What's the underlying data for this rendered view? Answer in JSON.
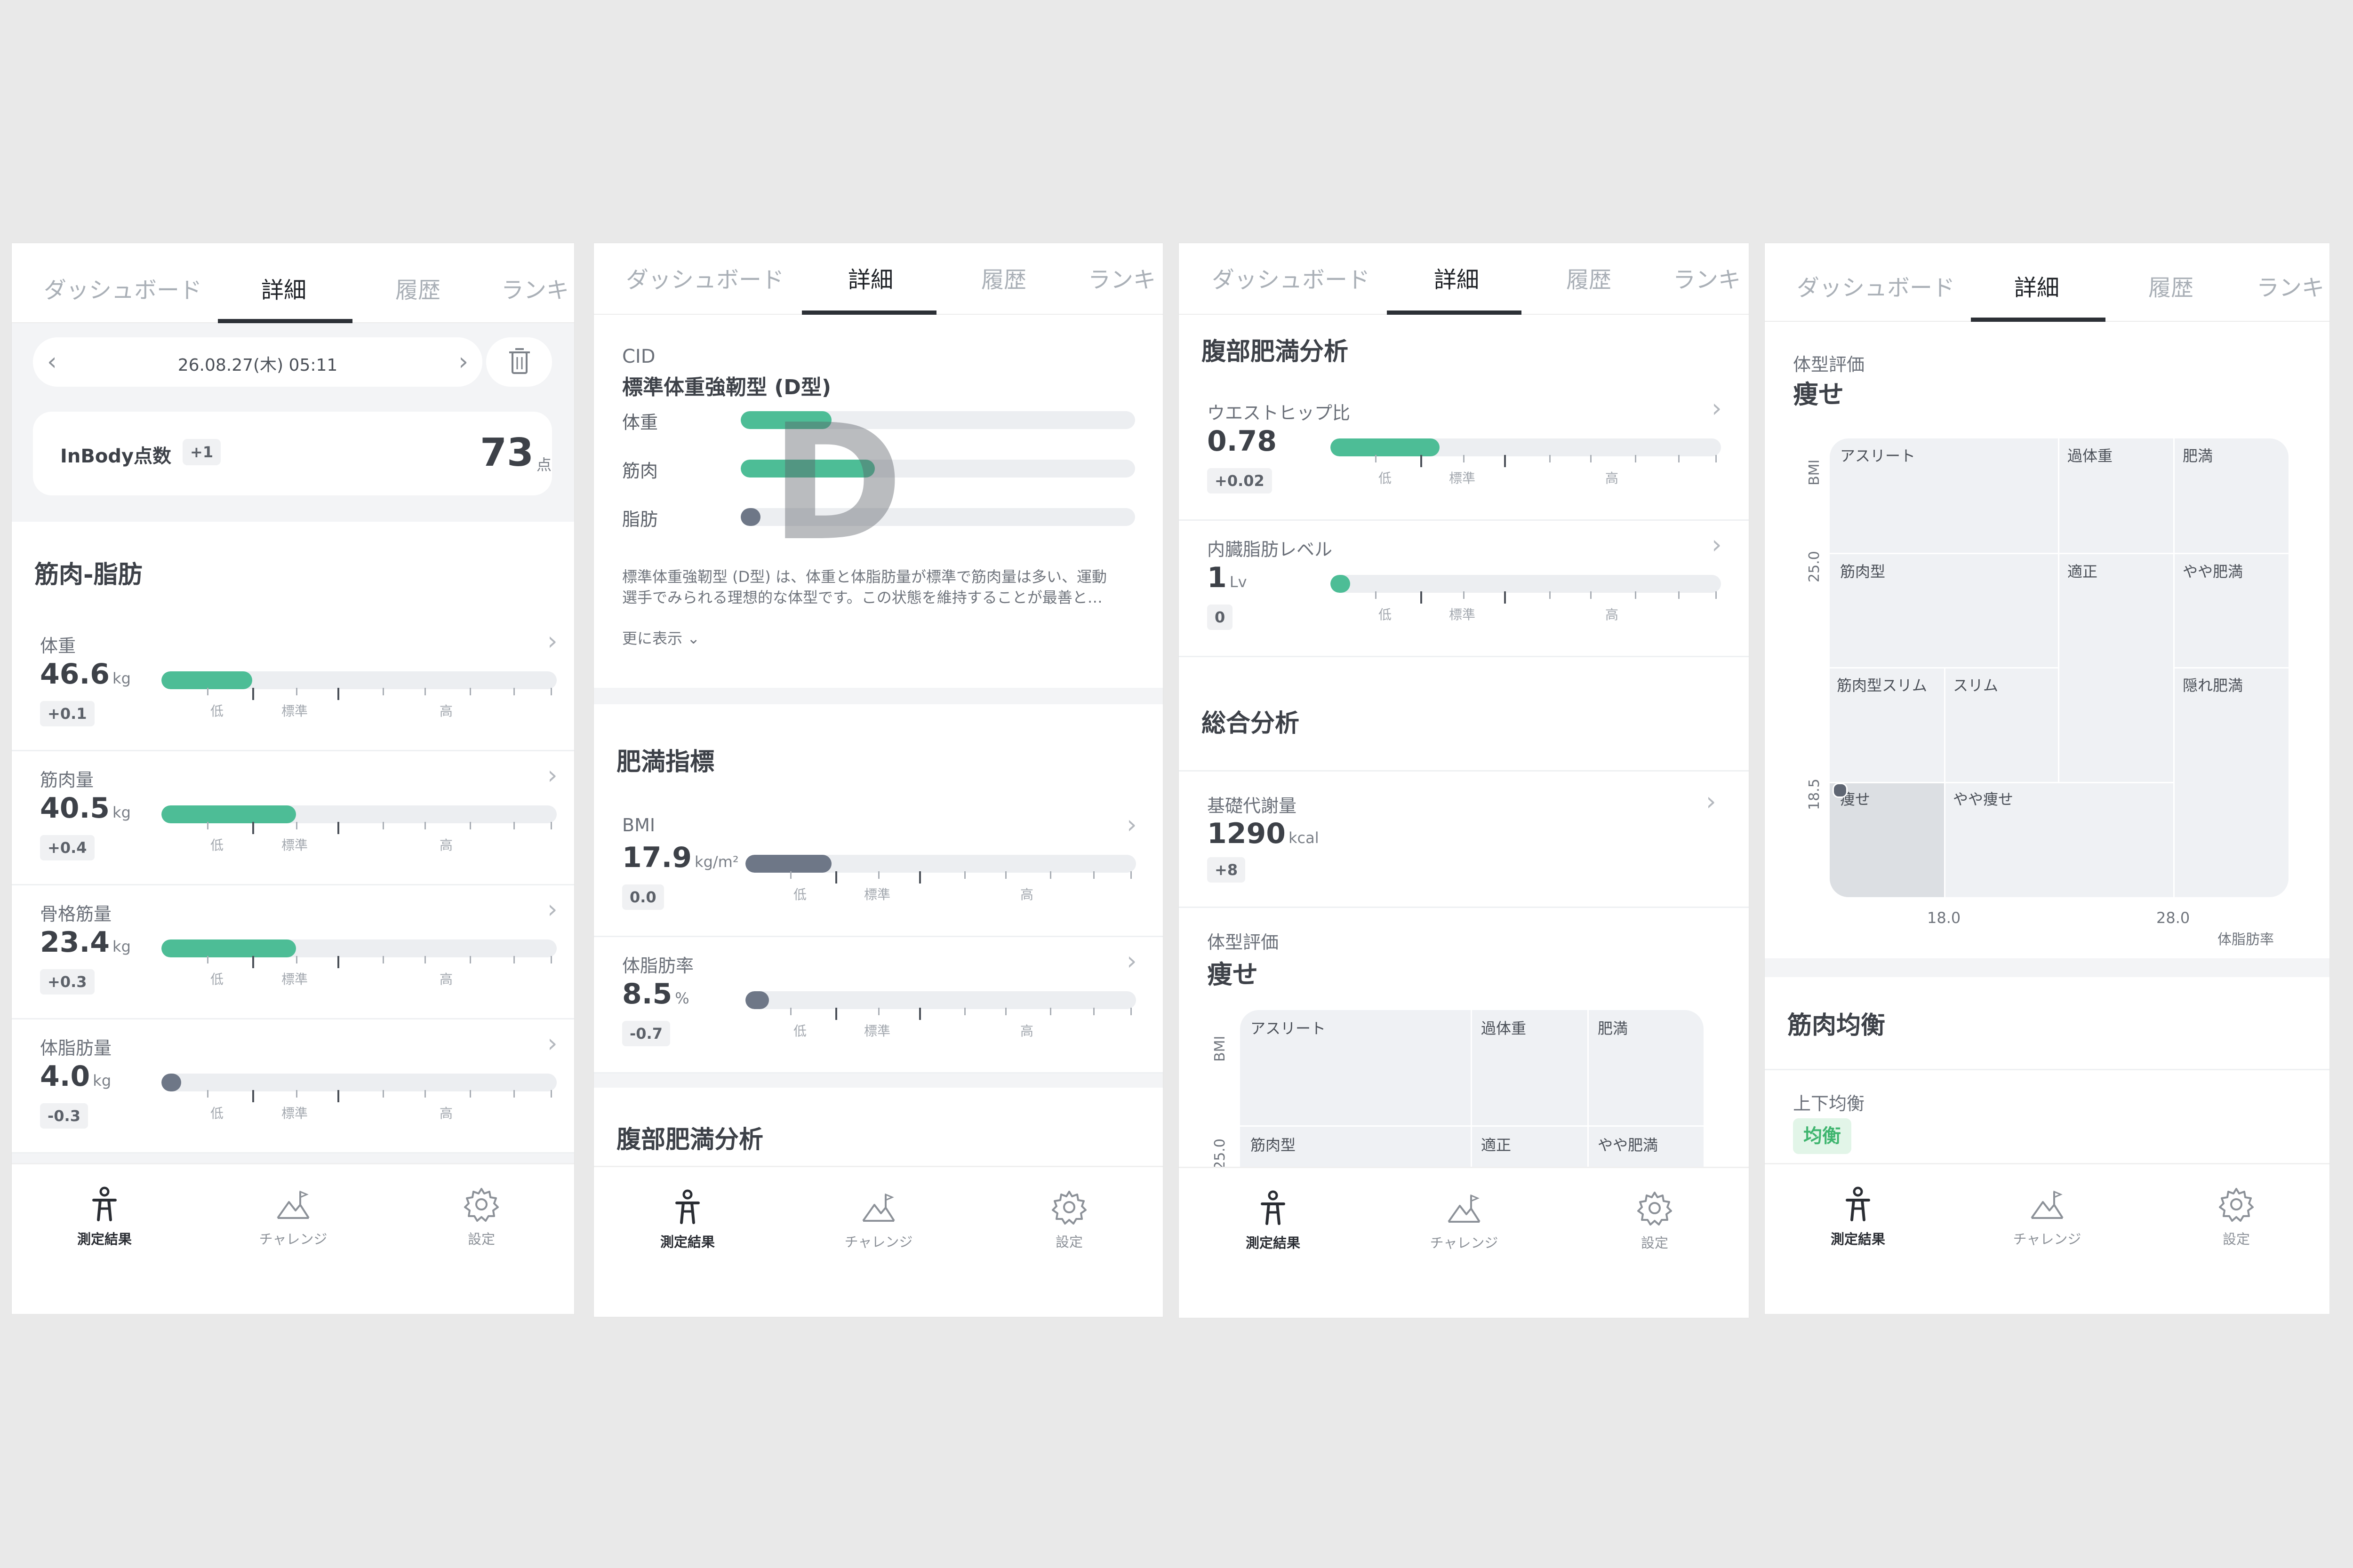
{
  "tabs": [
    "ダッシュボード",
    "詳細",
    "履歴",
    "ランキ"
  ],
  "bottom_nav": [
    {
      "label": "測定結果",
      "icon": "person-icon",
      "active": true
    },
    {
      "label": "チャレンジ",
      "icon": "mountain-flag-icon",
      "active": false
    },
    {
      "label": "設定",
      "icon": "gear-icon",
      "active": false
    }
  ],
  "bar_labels": {
    "low": "低",
    "std": "標準",
    "high": "高"
  },
  "screen1": {
    "date": "26.08.27(木) 05:11",
    "inbody_label": "InBody点数",
    "inbody_delta": "+1",
    "inbody_score": "73",
    "inbody_unit": "点",
    "section_title": "筋肉-脂肪",
    "metrics": [
      {
        "label": "体重",
        "value": "46.6",
        "unit": "kg",
        "delta": "+0.1",
        "fill": 0.23,
        "color": "green"
      },
      {
        "label": "筋肉量",
        "value": "40.5",
        "unit": "kg",
        "delta": "+0.4",
        "fill": 0.34,
        "color": "green"
      },
      {
        "label": "骨格筋量",
        "value": "23.4",
        "unit": "kg",
        "delta": "+0.3",
        "fill": 0.34,
        "color": "green"
      },
      {
        "label": "体脂肪量",
        "value": "4.0",
        "unit": "kg",
        "delta": "-0.3",
        "fill": 0.05,
        "color": "slate"
      }
    ]
  },
  "screen2": {
    "cid_label": "CID",
    "cid_type": "標準体重強靭型 (D型)",
    "cid_letter": "D",
    "cid_bars": [
      {
        "label": "体重",
        "fill": 0.23,
        "color": "green"
      },
      {
        "label": "筋肉",
        "fill": 0.34,
        "color": "green"
      },
      {
        "label": "脂肪",
        "fill": 0.05,
        "color": "slate"
      }
    ],
    "description_line1": "標準体重強靭型 (D型) は、体重と体脂肪量が標準で筋肉量は多い、運動",
    "description_line2": "選手でみられる理想的な体型です。この状態を維持することが最善と…",
    "more_label": "更に表示",
    "obesity_title": "肥満指標",
    "metrics": [
      {
        "label": "BMI",
        "value": "17.9",
        "unit": "kg/m²",
        "delta": "0.0",
        "fill": 0.22,
        "color": "slate"
      },
      {
        "label": "体脂肪率",
        "value": "8.5",
        "unit": "%",
        "delta": "-0.7",
        "fill": 0.06,
        "color": "slate"
      }
    ],
    "next_title": "腹部肥満分析"
  },
  "screen3": {
    "abdominal_title": "腹部肥満分析",
    "metrics": [
      {
        "label": "ウエストヒップ比",
        "value": "0.78",
        "unit": "",
        "delta": "+0.02",
        "fill": 0.28,
        "color": "green"
      },
      {
        "label": "内臓脂肪レベル",
        "value": "1",
        "unit": "Lv",
        "delta": "0",
        "fill": 0.05,
        "color": "green"
      }
    ],
    "overall_title": "総合分析",
    "bmr_label": "基礎代謝量",
    "bmr_value": "1290",
    "bmr_unit": "kcal",
    "bmr_delta": "+8",
    "bodytype_label": "体型評価",
    "bodytype_value": "痩せ",
    "chart_ylabel": "BMI",
    "chart_ytick": "25.0",
    "cells": [
      "アスリート",
      "過体重",
      "肥満",
      "筋肉型",
      "適正",
      "やや肥満"
    ]
  },
  "screen4": {
    "bodytype_label": "体型評価",
    "bodytype_value": "痩せ",
    "chart_ylabel": "BMI",
    "chart_xlabel": "体脂肪率",
    "y_ticks": [
      "25.0",
      "18.5"
    ],
    "x_ticks": [
      "18.0",
      "28.0"
    ],
    "cells": [
      "アスリート",
      "過体重",
      "肥満",
      "筋肉型",
      "適正",
      "やや肥満",
      "筋肉型スリム",
      "スリム",
      "隠れ肥満",
      "痩せ",
      "やや痩せ"
    ],
    "balance_title": "筋肉均衡",
    "balance_label": "上下均衡",
    "balance_value": "均衡"
  },
  "colors": {
    "green": "#4dbd96",
    "slate": "#6e7787",
    "badge_green": "#3fb56f"
  }
}
